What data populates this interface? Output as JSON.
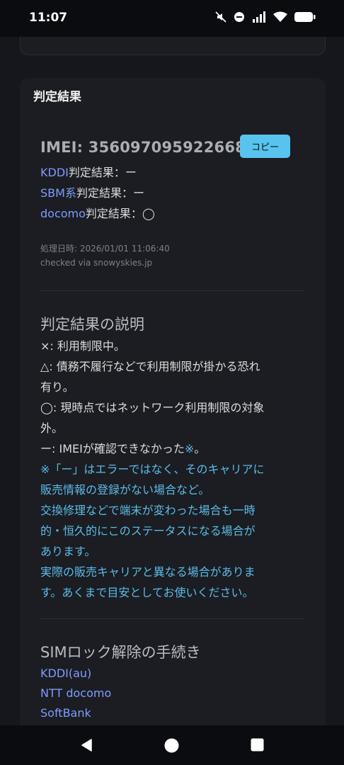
{
  "status_bar": {
    "time": "11:07",
    "icons": [
      "mute-icon",
      "dnd-icon",
      "signal-icon",
      "wifi-icon",
      "battery-icon"
    ]
  },
  "card": {
    "title": "判定結果",
    "imei_label": "IMEI: 356097095922668",
    "copy_label": "コピー",
    "results": [
      {
        "carrier": "KDDI",
        "suffix": "判定結果：ー"
      },
      {
        "carrier": "SBM系",
        "suffix": "判定結果：ー"
      },
      {
        "carrier": "docomo",
        "suffix": "判定結果：◯"
      }
    ],
    "processed_at": "処理日時: 2026/01/01 11:06:40",
    "checked_via": "checked via snowyskies.jp"
  },
  "explanation": {
    "title": "判定結果の説明",
    "lines": [
      "×: 利用制限中。",
      "△: 債務不履行などで利用制限が掛かる恐れ",
      "有り。",
      "◯: 現時点ではネットワーク利用制限の対象",
      "外。",
      "ー: IMEIが確認できなかった",
      "※「ー」はエラーではなく、そのキャリアに",
      "販売情報の登録がない場合など。",
      "交換修理などで端末が変わった場合も一時",
      "的・恒久的にこのステータスになる場合が",
      "あります。",
      "実際の販売キャリアと異なる場合がありま",
      "す。あくまで目安としてお使いください。"
    ],
    "note_mark": "※",
    "line6_tail": "。"
  },
  "sim_unlock": {
    "title": "SIMロック解除の手続き",
    "links": [
      "KDDI(au)",
      "NTT docomo",
      "SoftBank"
    ]
  },
  "colors": {
    "background": "#15171c",
    "card": "#1b1d22",
    "link": "#7f9bff",
    "note": "#5bbbe8",
    "copy_button": "#58c3ee"
  }
}
